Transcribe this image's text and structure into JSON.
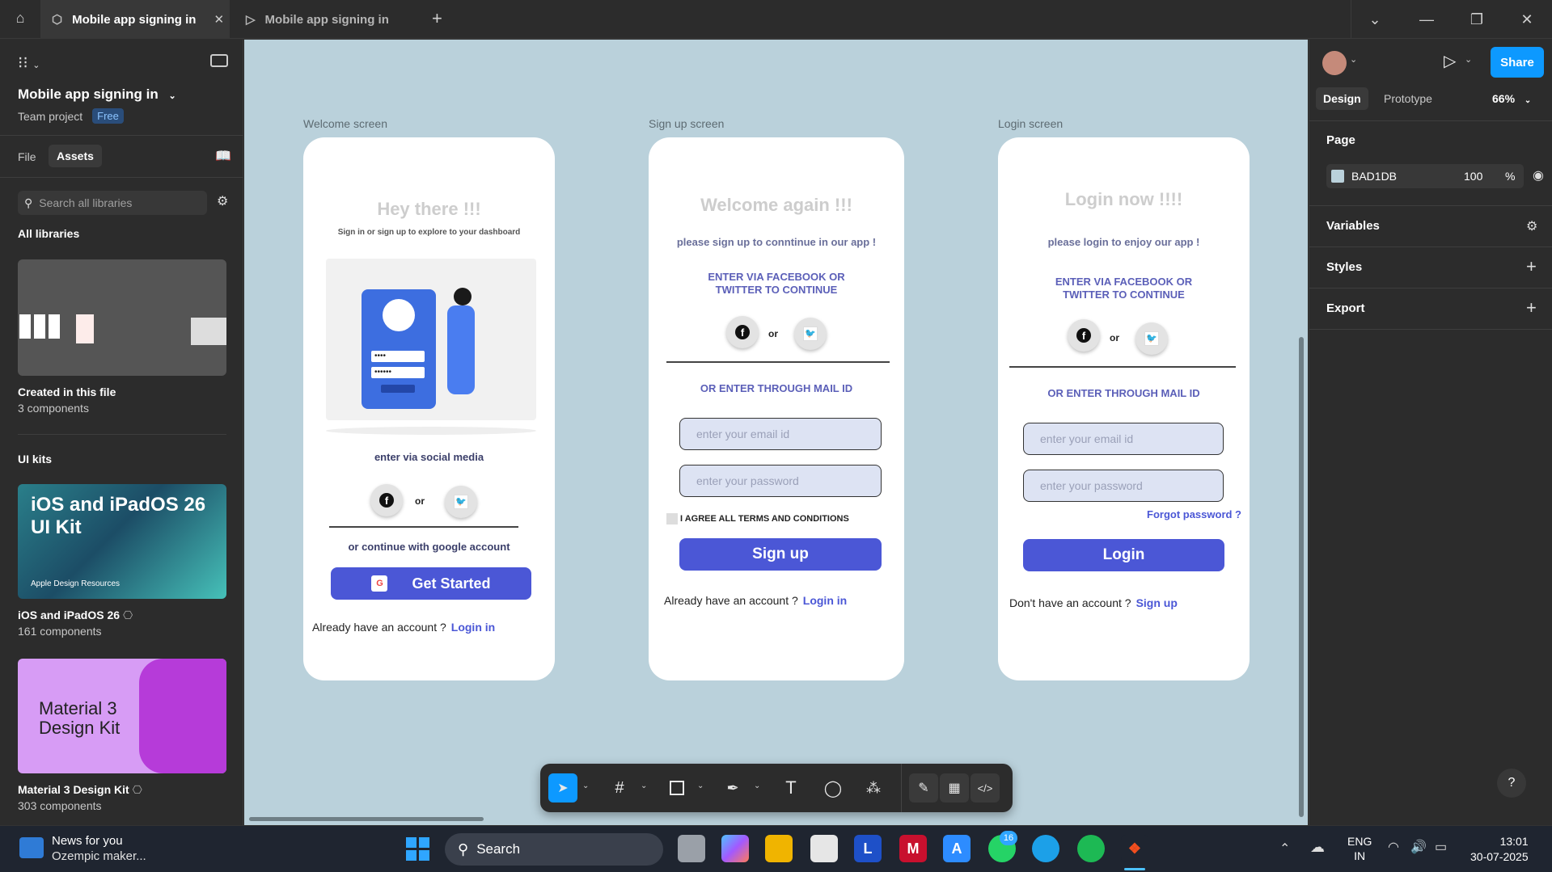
{
  "tabs": [
    {
      "label": "Mobile app signing in",
      "active": true
    },
    {
      "label": "Mobile app signing in",
      "active": false
    }
  ],
  "left": {
    "file_title": "Mobile app signing in",
    "team": "Team project",
    "plan": "Free",
    "tab_file": "File",
    "tab_assets": "Assets",
    "search_placeholder": "Search all libraries",
    "all_libraries": "All libraries",
    "created_title": "Created in this file",
    "created_count": "3 components",
    "ui_kits": "UI kits",
    "kits": [
      {
        "thumb_title": "iOS and iPadOS 26 UI Kit",
        "thumb_sub": "Apple Design Resources",
        "name": "iOS and iPadOS 26",
        "count": "161 components"
      },
      {
        "thumb_title": "Material 3 Design Kit",
        "name": "Material 3 Design Kit",
        "count": "303 components"
      }
    ]
  },
  "canvas": {
    "bg": "#BAD1DB",
    "welcome": {
      "label": "Welcome screen",
      "heading": "Hey there !!!",
      "sub": "Sign in or sign up to explore to your dashboard",
      "social_label": "enter via social media",
      "or": "or",
      "google_text": "or continue with google account",
      "button": "Get Started",
      "google_letter": "G",
      "have_account": "Already have an account ?",
      "login_link": "Login in",
      "pin": "••••",
      "password_dots": "••••••"
    },
    "signup": {
      "label": "Sign up screen",
      "heading": "Welcome again  !!!",
      "sub": "please sign up to conntinue in our app !",
      "via_line1": "ENTER VIA FACEBOOK OR",
      "via_line2": "TWITTER TO CONTINUE",
      "or": "or",
      "mail": "OR ENTER THROUGH MAIL ID",
      "email_ph": "enter your email  id",
      "password_ph": "enter your  password",
      "terms": "I AGREE ALL TERMS  AND CONDITIONS",
      "button": "Sign up",
      "have_account": "Already have an account ?",
      "login_link": "Login in"
    },
    "login": {
      "label": "Login screen",
      "heading": "Login now !!!!",
      "sub": "please login to enjoy our app !",
      "via_line1": "ENTER VIA FACEBOOK OR",
      "via_line2": "TWITTER TO CONTINUE",
      "or": "or",
      "mail": "OR ENTER THROUGH MAIL ID",
      "email_ph": "enter your email  id",
      "password_ph": "enter your  password",
      "forgot": "Forgot password ?",
      "button": "Login",
      "no_account": "Don't have an account ?",
      "signup_link": "Sign up"
    }
  },
  "right": {
    "share": "Share",
    "tab_design": "Design",
    "tab_prototype": "Prototype",
    "zoom": "66%",
    "page": "Page",
    "page_color": "BAD1DB",
    "opacity": "100",
    "percent": "%",
    "variables": "Variables",
    "styles": "Styles",
    "export": "Export",
    "help": "?"
  },
  "taskbar": {
    "news_title": "News for you",
    "news_sub": "Ozempic maker...",
    "search": "Search",
    "whatsapp_badge": "16",
    "lang1": "ENG",
    "lang2": "IN",
    "time": "13:01",
    "date": "30-07-2025"
  }
}
